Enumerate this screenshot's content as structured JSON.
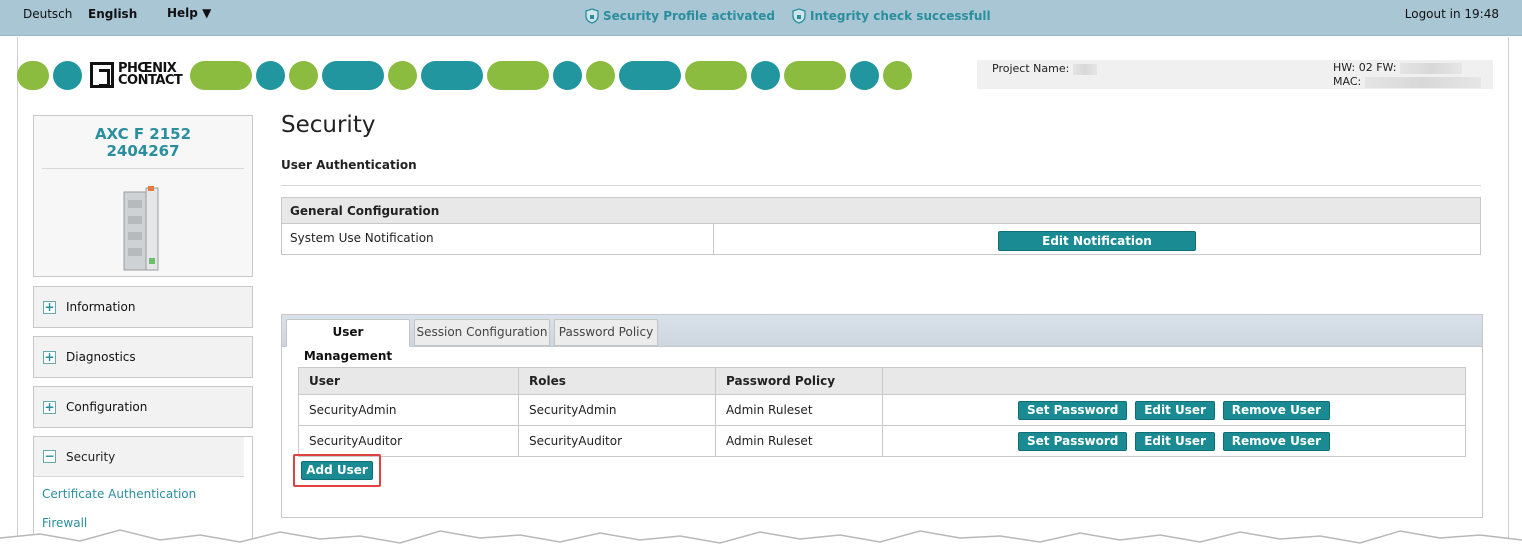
{
  "topbar": {
    "lang_de": "Deutsch",
    "lang_en": "English",
    "help": "Help ▼",
    "status1": "Security Profile activated",
    "status2": "Integrity check successfull",
    "logout": "Logout in 19:48"
  },
  "brand": {
    "logo_line1": "PHŒNIX",
    "logo_line2": "CONTACT",
    "colors": {
      "green": "#8bbb3f",
      "teal": "#21969f",
      "accent": "#1a8b93",
      "highlight": "#e0433f"
    }
  },
  "project": {
    "name_label": "Project Name:",
    "hw_label": "HW: 02 FW:",
    "mac_label": "MAC:"
  },
  "device": {
    "name": "AXC F 2152",
    "number": "2404267"
  },
  "sidebar": {
    "items": [
      {
        "label": "Information",
        "icon": "plus-icon"
      },
      {
        "label": "Diagnostics",
        "icon": "plus-icon"
      },
      {
        "label": "Configuration",
        "icon": "plus-icon"
      },
      {
        "label": "Security",
        "icon": "minus-icon"
      }
    ],
    "security_sub": [
      "Certificate Authentication",
      "Firewall"
    ]
  },
  "main": {
    "title": "Security",
    "subtitle": "User Authentication",
    "general": {
      "header": "General Configuration",
      "row_label": "System Use Notification",
      "edit_button": "Edit Notification"
    },
    "tabs": [
      "User Management",
      "Session Configuration",
      "Password Policy"
    ],
    "users": {
      "columns": [
        "User",
        "Roles",
        "Password Policy"
      ],
      "rows": [
        {
          "user": "SecurityAdmin",
          "role": "SecurityAdmin",
          "policy": "Admin Ruleset"
        },
        {
          "user": "SecurityAuditor",
          "role": "SecurityAuditor",
          "policy": "Admin Ruleset"
        }
      ],
      "actions": {
        "set_password": "Set Password",
        "edit_user": "Edit User",
        "remove_user": "Remove User"
      },
      "add_user": "Add User"
    }
  }
}
